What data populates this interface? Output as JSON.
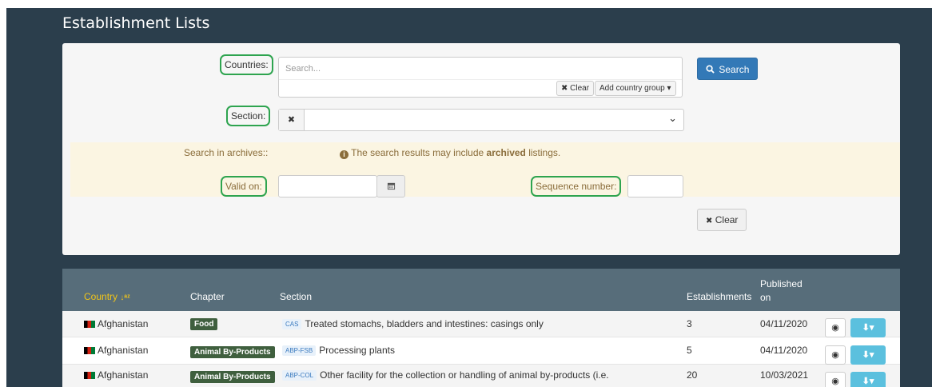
{
  "page": {
    "title": "Establishment Lists"
  },
  "search": {
    "countries_label": "Countries:",
    "countries_placeholder": "Search...",
    "clear_small": "✖ Clear",
    "add_country_group": "Add country group ▾",
    "search_button": "Search",
    "section_label": "Section:",
    "section_clear": "✖",
    "section_caret": "⌄",
    "archives_label": "Search in archives::",
    "archives_note_prefix": "The search results may include ",
    "archives_note_bold": "archived",
    "archives_note_suffix": " listings.",
    "valid_on_label": "Valid on:",
    "sequence_label": "Sequence number:",
    "clear_button": "Clear"
  },
  "table": {
    "headers": {
      "country": "Country",
      "sort_icon": "↓a/z",
      "chapter": "Chapter",
      "section": "Section",
      "establishments": "Establishments",
      "published_line1": "Published",
      "published_line2": "on"
    },
    "rows": [
      {
        "country": "Afghanistan",
        "chapter": "Food",
        "code": "CAS",
        "section": "Treated stomachs, bladders and intestines: casings only",
        "establishments": "3",
        "published": "04/11/2020"
      },
      {
        "country": "Afghanistan",
        "chapter": "Animal By-Products",
        "code": "ABP-FSB",
        "section": "Processing plants",
        "establishments": "5",
        "published": "04/11/2020"
      },
      {
        "country": "Afghanistan",
        "chapter": "Animal By-Products",
        "code": "ABP-COL",
        "section": "Other facility for the collection or handling of animal by-products (i.e.",
        "establishments": "20",
        "published": "10/03/2021"
      }
    ]
  },
  "colors": {
    "background": "#2b3e4c",
    "panel": "#f6f6f6",
    "highlight": "#2ea44f",
    "primary": "#3379b7",
    "table_header": "#576d7a",
    "country_header": "#f0c419",
    "download": "#5bc0de"
  },
  "icons": [
    "search-icon",
    "calendar-icon",
    "info-icon",
    "eye-icon",
    "download-icon",
    "sort-alpha-icon",
    "flag-icon"
  ]
}
